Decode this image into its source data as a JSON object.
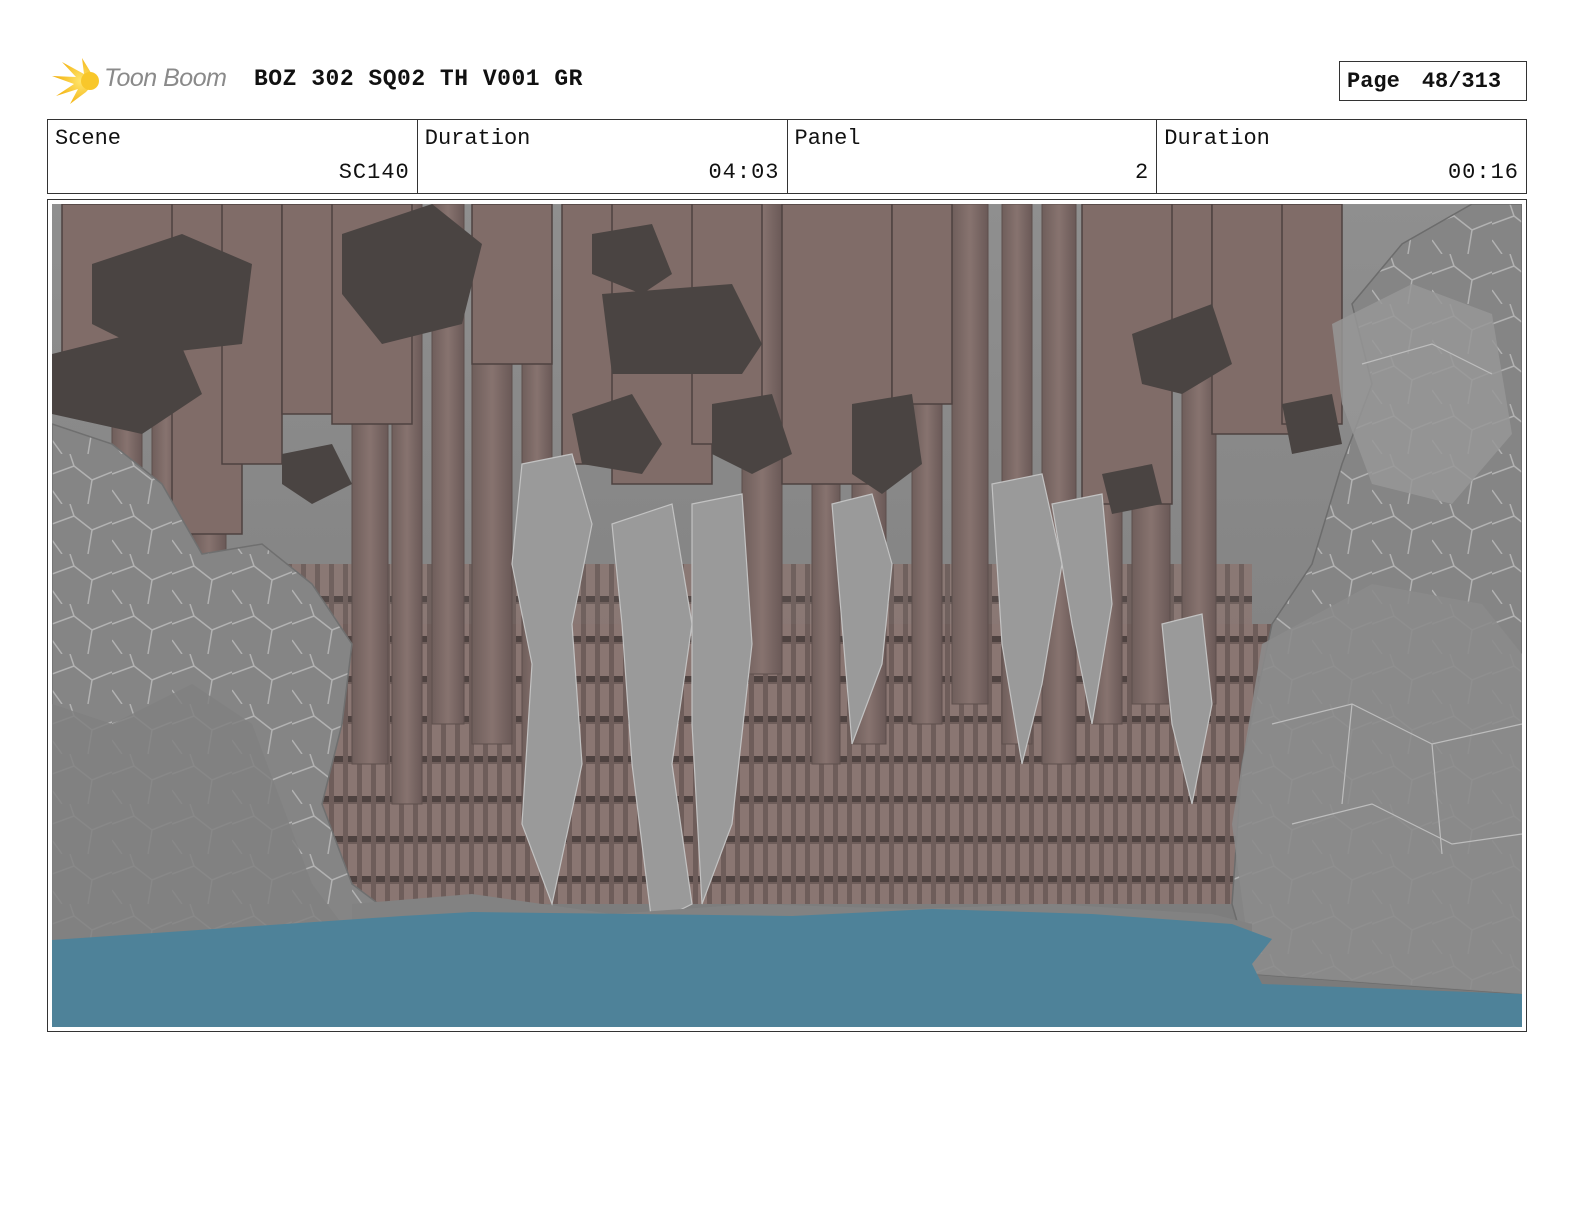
{
  "header": {
    "logo_text": "Toon Boom",
    "title": "BOZ 302 SQ02 TH V001 GR",
    "page_label": "Page",
    "page_number": "48/313"
  },
  "info": {
    "scene_label": "Scene",
    "scene_value": "SC140",
    "scene_duration_label": "Duration",
    "scene_duration_value": "04:03",
    "panel_label": "Panel",
    "panel_value": "2",
    "panel_duration_label": "Duration",
    "panel_duration_value": "00:16"
  },
  "colors": {
    "logo_yellow": "#f5c518",
    "water": "#4e8299",
    "rock_gray": "#8a8a8a",
    "column_brown": "#7e6a66"
  },
  "icons": {
    "logo": "toon-boom-logo-icon"
  }
}
